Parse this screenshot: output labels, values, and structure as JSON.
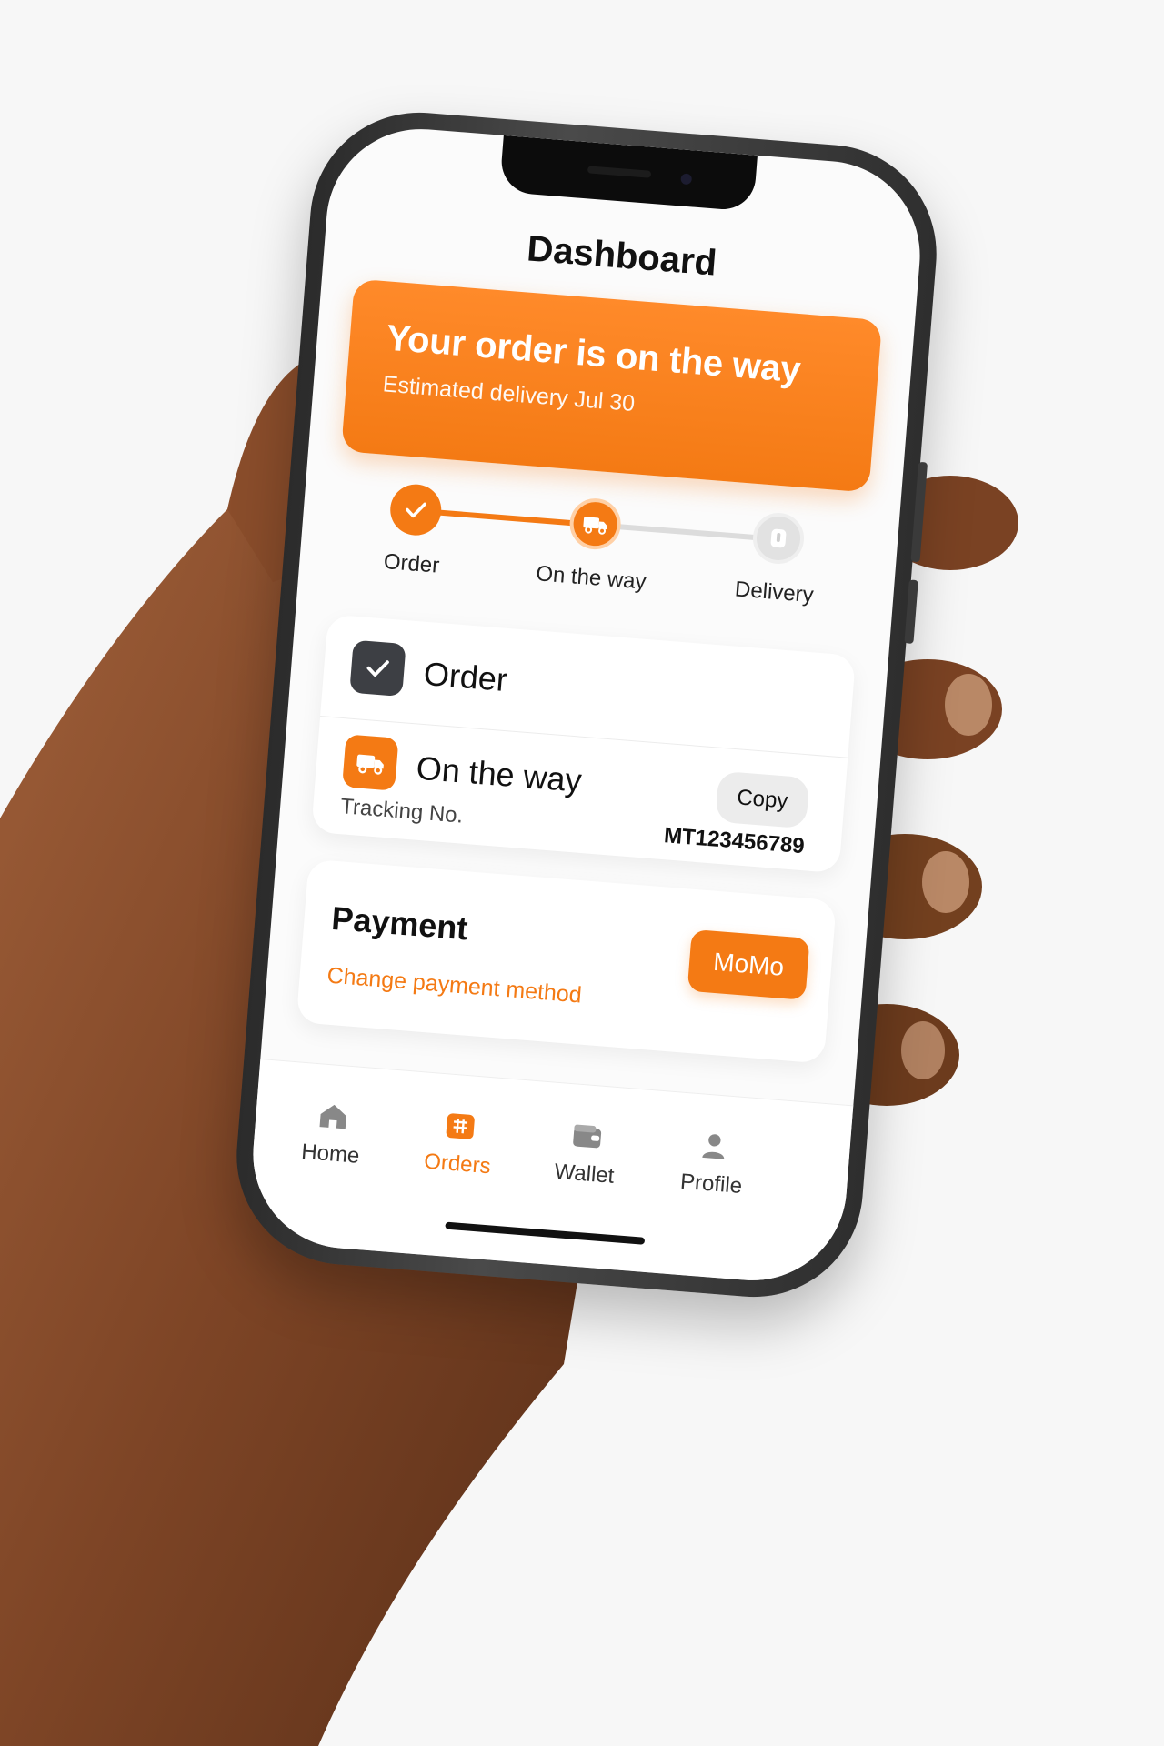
{
  "screen": {
    "title": "Dashboard"
  },
  "banner": {
    "headline": "Your order is on the way",
    "subtitle": "Estimated delivery Jul 30"
  },
  "stepper": {
    "steps": [
      {
        "label": "Order",
        "state": "done"
      },
      {
        "label": "On the way",
        "state": "active"
      },
      {
        "label": "Delivery",
        "state": "pending"
      }
    ]
  },
  "order_card": {
    "order_label": "Order",
    "on_the_way_label": "On the way",
    "copy_button": "Copy",
    "tracking_label": "Tracking No.",
    "tracking_number": "MT123456789"
  },
  "payment_card": {
    "title": "Payment",
    "change_link": "Change payment method",
    "method_button": "MoMo"
  },
  "tabbar": {
    "items": [
      {
        "label": "Home",
        "icon": "home-icon",
        "active": false
      },
      {
        "label": "Orders",
        "icon": "orders-icon",
        "active": true
      },
      {
        "label": "Wallet",
        "icon": "wallet-icon",
        "active": false
      },
      {
        "label": "Profile",
        "icon": "profile-icon",
        "active": false
      }
    ]
  },
  "colors": {
    "accent": "#f47a14",
    "background": "#fbfbfb",
    "text": "#111111",
    "inactive": "#d6d6d6"
  }
}
